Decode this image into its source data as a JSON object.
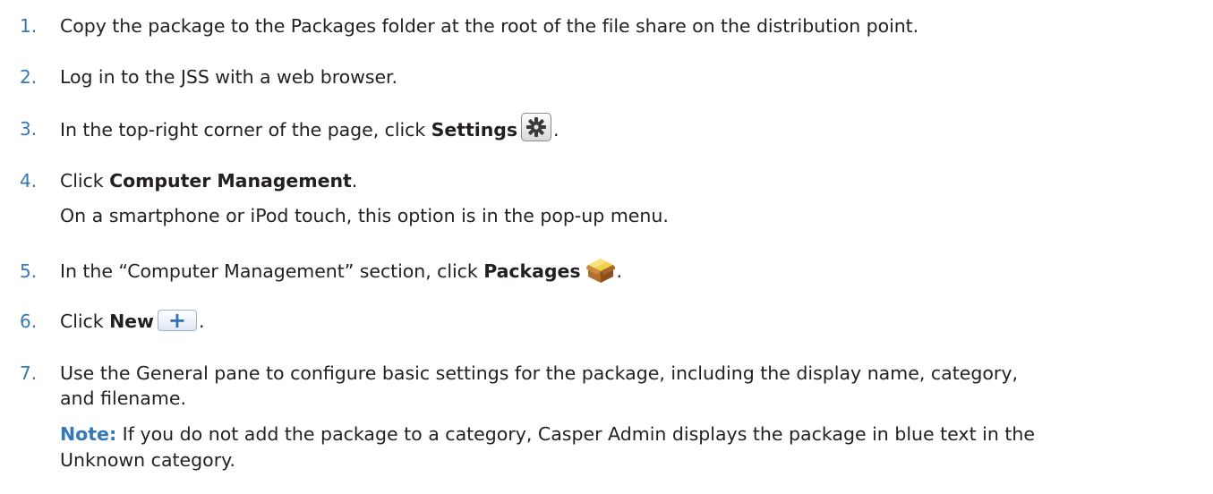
{
  "steps": [
    {
      "number": "1.",
      "text": "Copy the package to the Packages folder at the root of the file share on the distribution point."
    },
    {
      "number": "2.",
      "text": "Log in to the JSS with a web browser."
    },
    {
      "number": "3.",
      "prefix": "In the top-right corner of the page, click ",
      "bold": "Settings",
      "icon": "gear-icon",
      "suffix": "."
    },
    {
      "number": "4.",
      "prefix": "Click ",
      "bold": "Computer Management",
      "suffix": ".",
      "sub": "On a smartphone or iPod touch, this option is in the pop-up menu."
    },
    {
      "number": "5.",
      "prefix": "In the “Computer Management” section, click ",
      "bold": "Packages",
      "icon": "package-icon",
      "suffix": "."
    },
    {
      "number": "6.",
      "prefix": "Click ",
      "bold": "New",
      "icon": "plus-icon",
      "button_glyph": "+",
      "suffix": "."
    },
    {
      "number": "7.",
      "line1": "Use the General pane to configure basic settings for the package, including the display name, category,",
      "line2": "and filename.",
      "note_label": "Note:",
      "note_line1": " If you do not add the package to a category, Casper Admin displays the package in blue text in the",
      "note_line2": "Unknown category."
    }
  ],
  "colors": {
    "number": "#3478b5",
    "text": "#231f20",
    "note_label": "#3478b5"
  }
}
